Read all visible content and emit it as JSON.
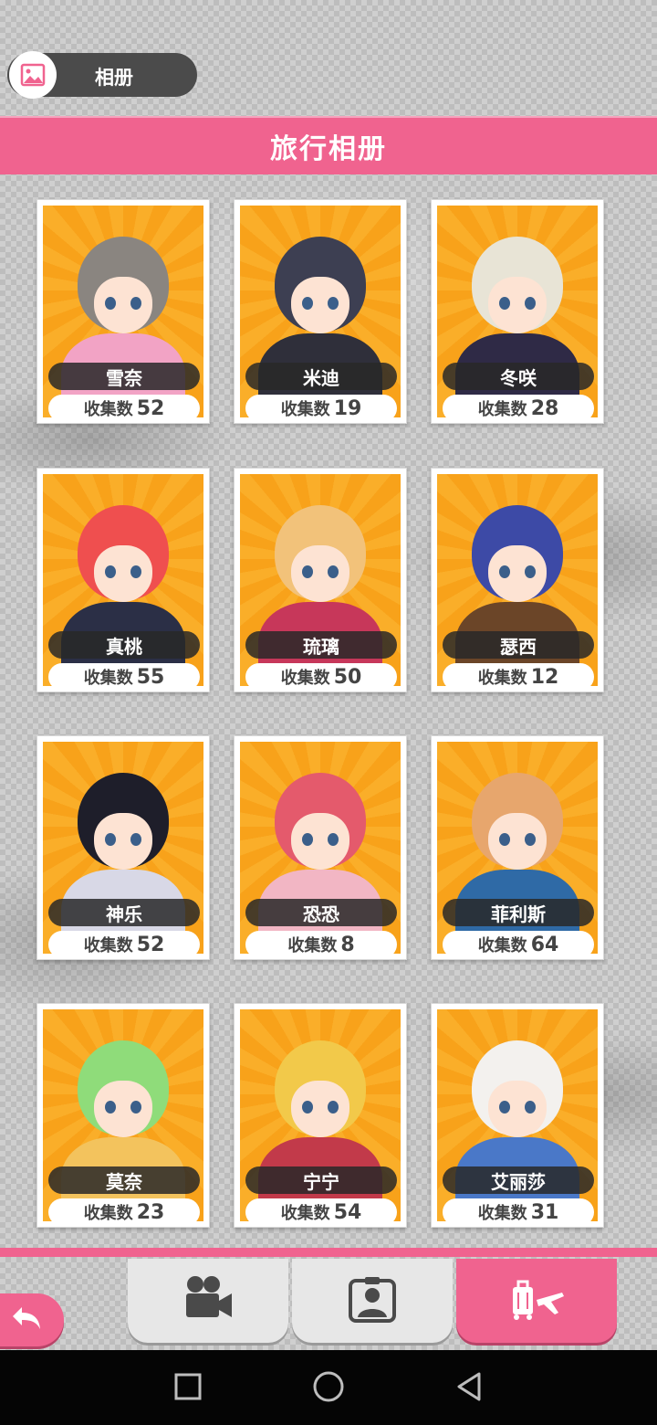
{
  "header": {
    "album_label": "相册",
    "album_icon": "photo-icon"
  },
  "banner": {
    "title": "旅行相册"
  },
  "collect_label": "收集数",
  "characters": [
    {
      "name": "雪奈",
      "count": "52",
      "hair": "#8a8580",
      "outfit": "#f2a3c5"
    },
    {
      "name": "米迪",
      "count": "19",
      "hair": "#3d3f52",
      "outfit": "#2f2f3a"
    },
    {
      "name": "冬咲",
      "count": "28",
      "hair": "#e8e4d6",
      "outfit": "#2f2a46"
    },
    {
      "name": "真桃",
      "count": "55",
      "hair": "#ef4f4f",
      "outfit": "#2b2f46"
    },
    {
      "name": "琉璃",
      "count": "50",
      "hair": "#f2c27a",
      "outfit": "#c7375a"
    },
    {
      "name": "瑟西",
      "count": "12",
      "hair": "#3d4aa6",
      "outfit": "#6b4528"
    },
    {
      "name": "神乐",
      "count": "52",
      "hair": "#1e1e2a",
      "outfit": "#d8d8e6"
    },
    {
      "name": "恐恐",
      "count": "8",
      "hair": "#e45a6c",
      "outfit": "#f2b6c4"
    },
    {
      "name": "菲利斯",
      "count": "64",
      "hair": "#e7a66d",
      "outfit": "#2f6aa6"
    },
    {
      "name": "莫奈",
      "count": "23",
      "hair": "#8fdc7a",
      "outfit": "#f3c35d"
    },
    {
      "name": "宁宁",
      "count": "54",
      "hair": "#f2c94a",
      "outfit": "#c23a4a"
    },
    {
      "name": "艾丽莎",
      "count": "31",
      "hair": "#f3f1ee",
      "outfit": "#4a78c8"
    }
  ],
  "tabs": [
    {
      "id": "video",
      "icon": "video-camera-icon"
    },
    {
      "id": "portrait",
      "icon": "portrait-icon"
    },
    {
      "id": "travel",
      "icon": "luggage-plane-icon",
      "active": true
    }
  ],
  "back_icon": "back-arrow-icon",
  "system_nav": [
    "recents-square-icon",
    "home-circle-icon",
    "back-triangle-icon"
  ],
  "colors": {
    "accent": "#f0638f",
    "card_bg": "#f9a51b",
    "pill_dark": "#3a3a3a"
  }
}
